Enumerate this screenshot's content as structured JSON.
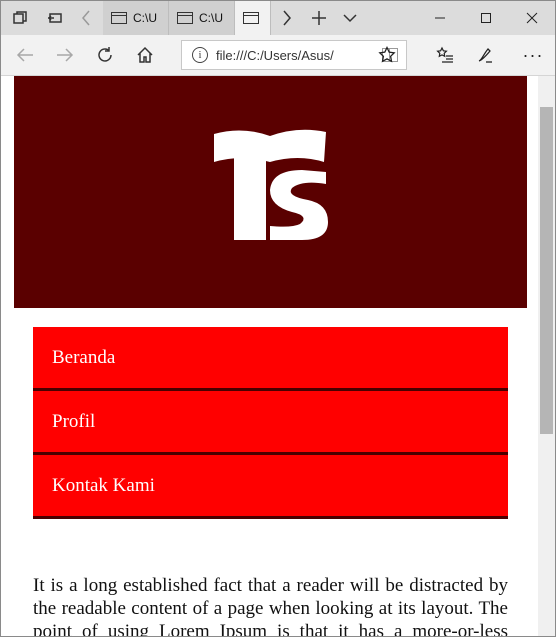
{
  "browser": {
    "tabs": [
      {
        "label": "C:\\U"
      },
      {
        "label": "C:\\U"
      }
    ],
    "address": {
      "url": "file:///C:/Users/Asus/"
    }
  },
  "page": {
    "menu": [
      {
        "label": "Beranda"
      },
      {
        "label": "Profil"
      },
      {
        "label": "Kontak Kami"
      }
    ],
    "paragraph": "It is a long established fact that a reader will be distracted by the readable content of a page when looking at its layout. The point of using Lorem Ipsum is that it has a more-or-less normal distribution of letters."
  },
  "colors": {
    "hero_bg": "#5a0000",
    "menu_bg": "#ff0000",
    "menu_divider": "#4a0000"
  }
}
